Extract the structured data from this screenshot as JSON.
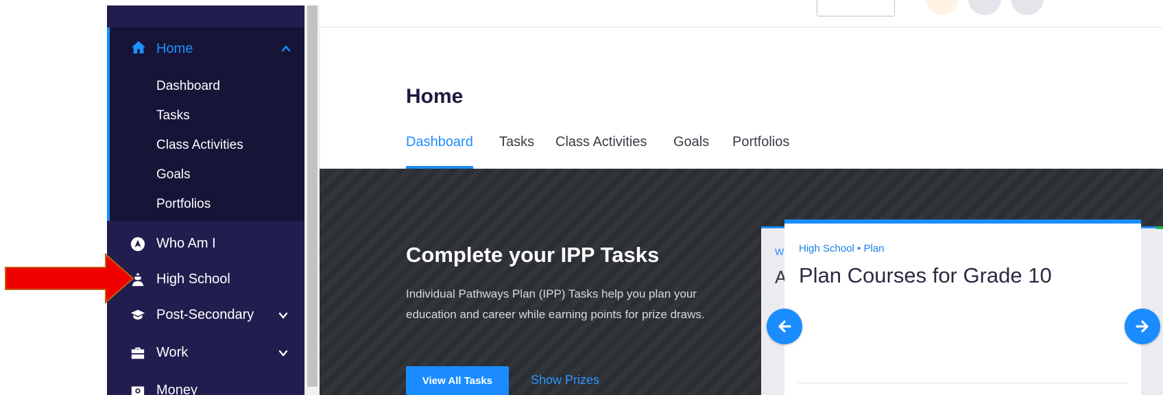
{
  "sidebar": {
    "home": {
      "label": "Home",
      "icon": "home-icon",
      "expanded": true
    },
    "sub_items": [
      {
        "label": "Dashboard"
      },
      {
        "label": "Tasks"
      },
      {
        "label": "Class Activities"
      },
      {
        "label": "Goals"
      },
      {
        "label": "Portfolios"
      }
    ],
    "items": [
      {
        "label": "Who Am I",
        "icon": "compass-icon"
      },
      {
        "label": "High School",
        "icon": "student-icon"
      },
      {
        "label": "Post-Secondary",
        "icon": "graduation-cap-icon"
      },
      {
        "label": "Work",
        "icon": "briefcase-icon"
      },
      {
        "label": "Money",
        "icon": "money-icon"
      }
    ]
  },
  "page": {
    "title": "Home",
    "tabs": [
      {
        "label": "Dashboard",
        "active": true
      },
      {
        "label": "Tasks"
      },
      {
        "label": "Class Activities"
      },
      {
        "label": "Goals"
      },
      {
        "label": "Portfolios"
      }
    ]
  },
  "banner": {
    "title": "Complete your IPP Tasks",
    "description": "Individual Pathways Plan (IPP) Tasks help you plan your education and career while earning points for prize draws.",
    "primary_button": "View All Tasks",
    "secondary_link": "Show Prizes"
  },
  "carousel": {
    "back_card_peek": {
      "kicker": "W",
      "title": "A"
    },
    "card": {
      "kicker": "High School • Plan",
      "title": "Plan Courses for Grade 10"
    },
    "prev_icon": "arrow-left-icon",
    "next_icon": "arrow-right-icon"
  },
  "colors": {
    "sidebar_bg": "#211d4f",
    "sidebar_active_bg": "#161437",
    "accent": "#1a8cff",
    "banner_bg": "#2b2e33",
    "annotation_arrow": "#f00000"
  }
}
